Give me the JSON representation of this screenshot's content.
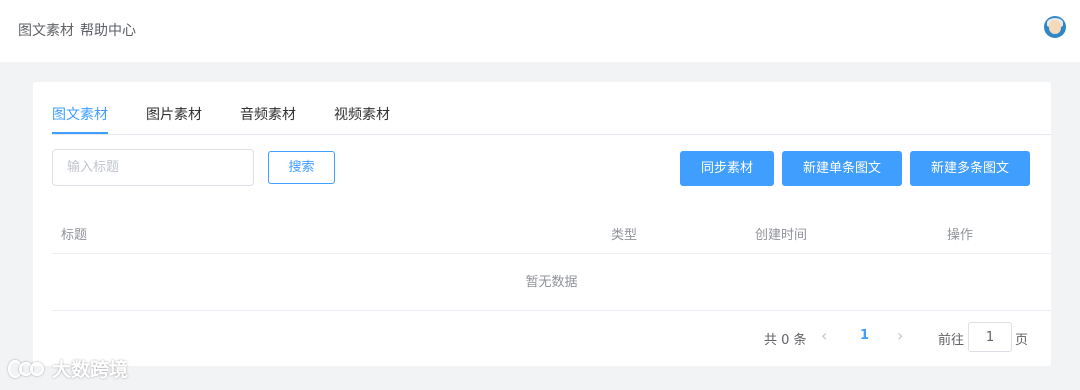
{
  "breadcrumb": {
    "section": "图文素材",
    "help": "帮助中心"
  },
  "tabs": [
    {
      "label": "图文素材",
      "active": true
    },
    {
      "label": "图片素材",
      "active": false
    },
    {
      "label": "音频素材",
      "active": false
    },
    {
      "label": "视频素材",
      "active": false
    }
  ],
  "search": {
    "placeholder": "输入标题",
    "value": "",
    "button": "搜索"
  },
  "actions": {
    "sync": "同步素材",
    "new_single": "新建单条图文",
    "new_multi": "新建多条图文"
  },
  "table": {
    "columns": [
      "标题",
      "类型",
      "创建时间",
      "操作"
    ],
    "empty_text": "暂无数据"
  },
  "pagination": {
    "total_text": "共 0 条",
    "prev": "‹",
    "current_page": "1",
    "next": "›",
    "goto_label": "前往",
    "goto_value": "1",
    "page_suffix": "页"
  },
  "watermark": {
    "text": "大数跨境"
  },
  "colors": {
    "accent": "#409eff",
    "page_bg": "#f2f3f5",
    "border": "#dcdfe6"
  }
}
